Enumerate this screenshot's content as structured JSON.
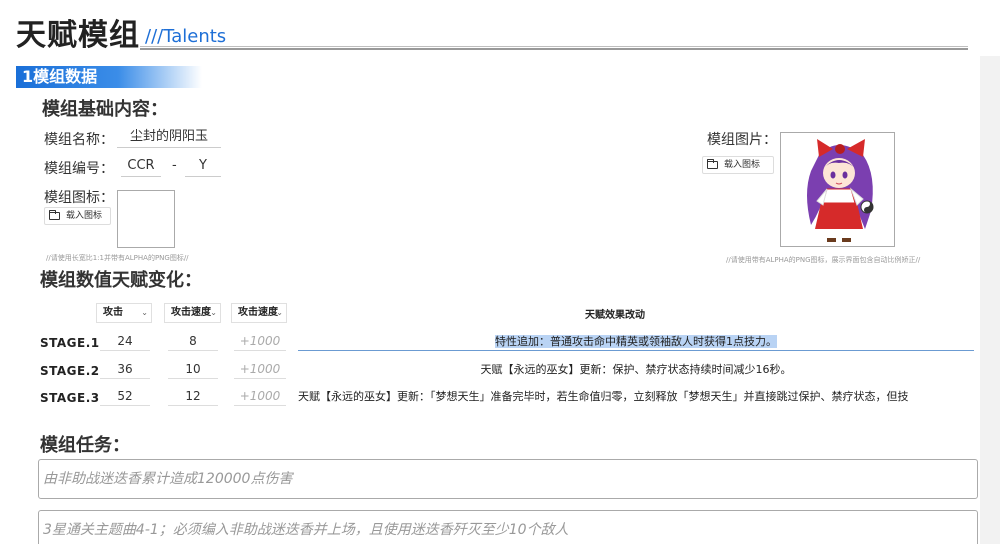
{
  "header": {
    "title": "天赋模组",
    "subtitle": "///Talents"
  },
  "section": {
    "label": "1模组数据"
  },
  "basic": {
    "heading": "模组基础内容：",
    "name_label": "模组名称：",
    "name_value": "尘封的阴阳玉",
    "code_label": "模组编号：",
    "code_part1": "CCR",
    "code_sep": "-",
    "code_part2": "Y",
    "icon_label": "模组图标：",
    "load_icon_label": "载入图标",
    "icon_hint": "//请使用长宽比1:1并带有ALPHA的PNG图标//",
    "image_label": "模组图片：",
    "load_image_label": "载入图标",
    "image_hint": "//请使用带有ALPHA的PNG图标，展示界面包含自动比例矫正//"
  },
  "talents": {
    "heading": "模组数值天赋变化：",
    "dropdowns": [
      "攻击",
      "攻击速度",
      "攻击速度"
    ],
    "effect_header": "天赋效果改动",
    "rows": [
      {
        "stage": "STAGE.1",
        "v1": "24",
        "v2": "8",
        "v3": "+1000",
        "effect": "特性追加：普通攻击命中精英或领袖敌人时获得1点技力。"
      },
      {
        "stage": "STAGE.2",
        "v1": "36",
        "v2": "10",
        "v3": "+1000",
        "effect": "天赋【永远的巫女】更新：保护、禁疗状态持续时间减少16秒。"
      },
      {
        "stage": "STAGE.3",
        "v1": "52",
        "v2": "12",
        "v3": "+1000",
        "effect": "天赋【永远的巫女】更新：「梦想天生」准备完毕时，若生命值归零，立刻释放「梦想天生」并直接跳过保护、禁疗状态，但技"
      }
    ]
  },
  "tasks": {
    "heading": "模组任务：",
    "items": [
      "由非助战迷迭香累计造成120000点伤害",
      "3星通关主题曲4-1；必须编入非助战迷迭香并上场，且使用迷迭香歼灭至少10个敌人"
    ]
  },
  "colors": {
    "accent": "#1a6fd8",
    "selection": "#b9d3f4"
  }
}
